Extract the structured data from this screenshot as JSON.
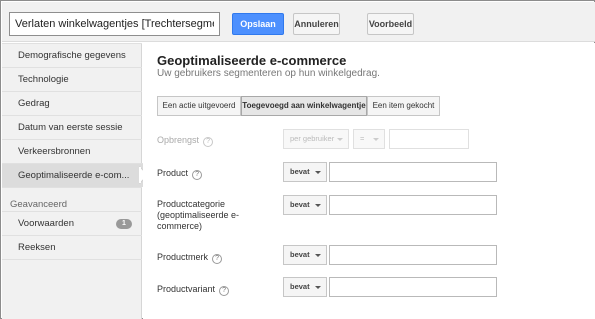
{
  "toolbar": {
    "segment_name": "Verlaten winkelwagentjes [Trechtersegment]",
    "save_label": "Opslaan",
    "cancel_label": "Annuleren",
    "preview_label": "Voorbeeld"
  },
  "sidebar": {
    "items": [
      {
        "label": "Demografische gegevens"
      },
      {
        "label": "Technologie"
      },
      {
        "label": "Gedrag"
      },
      {
        "label": "Datum van eerste sessie"
      },
      {
        "label": "Verkeersbronnen"
      },
      {
        "label": "Geoptimaliseerde e-com..."
      }
    ],
    "advanced_label": "Geavanceerd",
    "advanced_items": [
      {
        "label": "Voorwaarden",
        "badge": "1"
      },
      {
        "label": "Reeksen"
      }
    ]
  },
  "main": {
    "title": "Geoptimaliseerde e-commerce",
    "subtitle": "Uw gebruikers segmenteren op hun winkelgedrag.",
    "tabs": [
      {
        "label": "Een actie uitgevoerd",
        "active": false
      },
      {
        "label": "Toegevoegd aan winkelwagentje",
        "active": true
      },
      {
        "label": "Een item gekocht",
        "active": false
      }
    ],
    "rows": {
      "revenue": {
        "label": "Opbrengst",
        "scope": "per gebruiker",
        "operator": "=",
        "value": ""
      },
      "product": {
        "label": "Product",
        "operator": "bevat",
        "value": ""
      },
      "category": {
        "label": "Productcategorie (geoptimaliseerde e-commerce)",
        "operator": "bevat",
        "value": ""
      },
      "brand": {
        "label": "Productmerk",
        "operator": "bevat",
        "value": ""
      },
      "variant": {
        "label": "Productvariant",
        "operator": "bevat",
        "value": ""
      }
    },
    "help_glyph": "?"
  },
  "colors": {
    "primary_button": "#4d90fe",
    "sidebar_bg": "#f1f1f1",
    "active_nav_bg": "#dcdcdc"
  },
  "icons": {
    "help": "help-icon",
    "caret": "caret-down-icon",
    "nav_pointer": "active-pointer-icon"
  }
}
